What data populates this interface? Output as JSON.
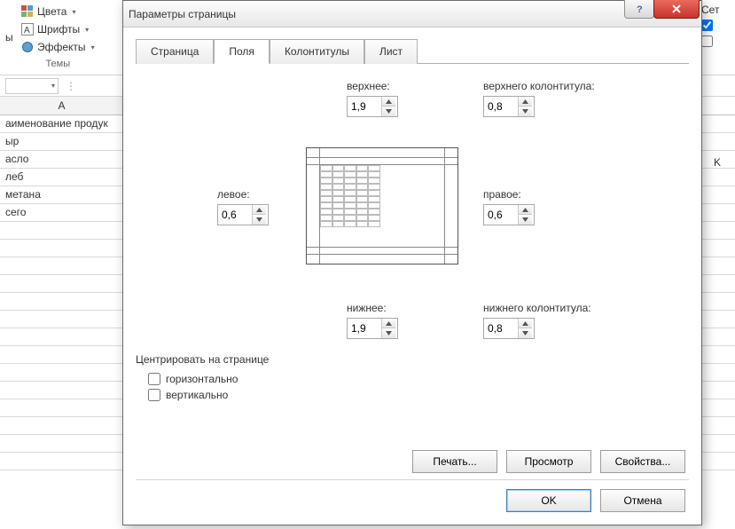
{
  "ribbon": {
    "colors": "Цвета",
    "fonts": "Шрифты",
    "effects": "Эффекты",
    "themes_label": "Темы",
    "truncated_left": "ы"
  },
  "sheet": {
    "col_a": "A",
    "col_k": "K",
    "rows": [
      "аименование продук",
      "ыр",
      "асло",
      "леб",
      "метана",
      "сего"
    ]
  },
  "right": {
    "label": "Сет",
    "chk1": true,
    "chk2": false
  },
  "dialog": {
    "title": "Параметры страницы",
    "tabs": [
      "Страница",
      "Поля",
      "Колонтитулы",
      "Лист"
    ],
    "active_tab": 1,
    "margins": {
      "top_label": "верхнее:",
      "top": "1,9",
      "header_label": "верхнего колонтитула:",
      "header": "0,8",
      "left_label": "левое:",
      "left": "0,6",
      "right_label": "правое:",
      "right": "0,6",
      "bottom_label": "нижнее:",
      "bottom": "1,9",
      "footer_label": "нижнего колонтитула:",
      "footer": "0,8"
    },
    "center_title": "Центрировать на странице",
    "center_h": "горизонтально",
    "center_v": "вертикально",
    "center_h_checked": false,
    "center_v_checked": false,
    "btn_print": "Печать...",
    "btn_preview": "Просмотр",
    "btn_props": "Свойства...",
    "btn_ok": "OK",
    "btn_cancel": "Отмена"
  }
}
